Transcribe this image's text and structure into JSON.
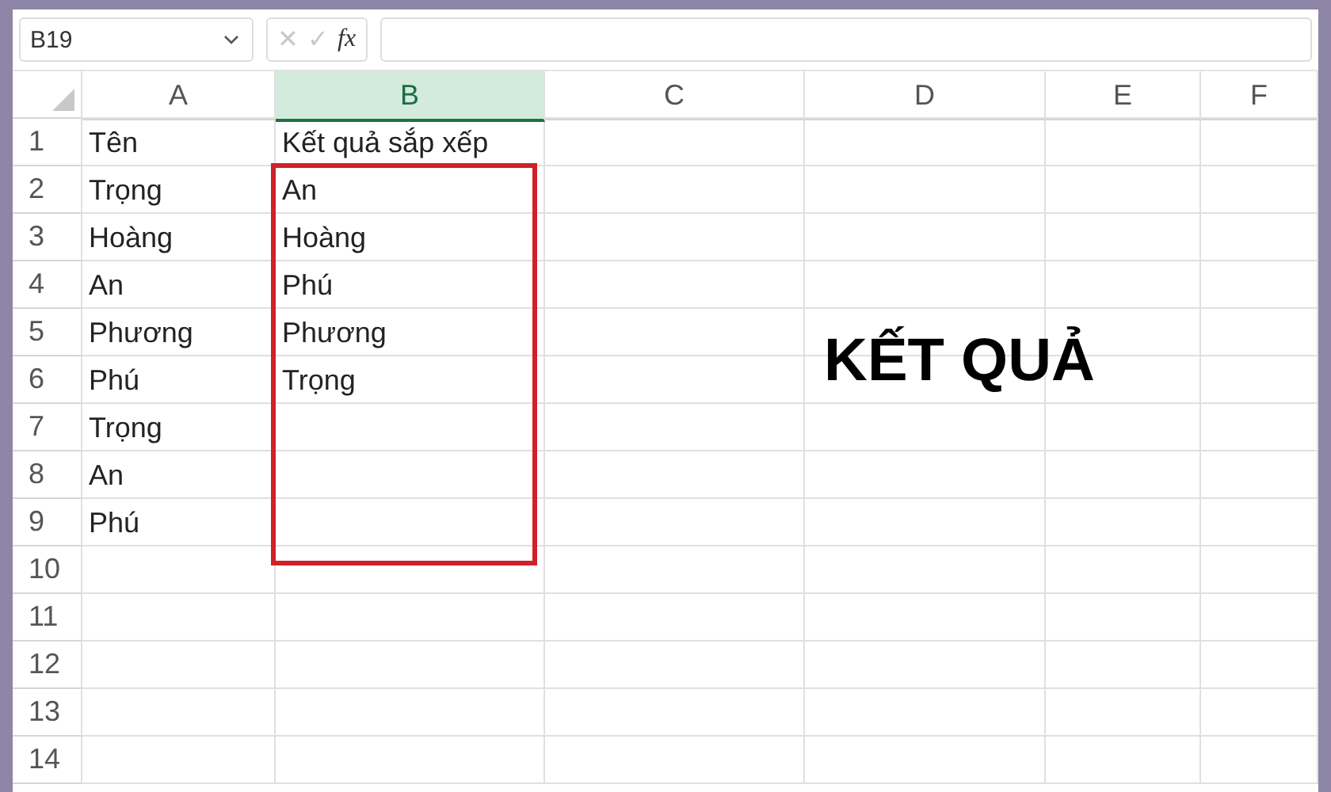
{
  "formula_bar": {
    "name_box": "B19",
    "cancel": "✕",
    "enter": "✓",
    "function": "fx"
  },
  "columns": [
    {
      "label": "A",
      "selected": false
    },
    {
      "label": "B",
      "selected": true
    },
    {
      "label": "C",
      "selected": false
    },
    {
      "label": "D",
      "selected": false
    },
    {
      "label": "E",
      "selected": false
    },
    {
      "label": "F",
      "selected": false
    }
  ],
  "rows": [
    {
      "number": "1",
      "cells": [
        "Tên",
        "Kết quả sắp xếp"
      ]
    },
    {
      "number": "2",
      "cells": [
        "Trọng",
        "An"
      ]
    },
    {
      "number": "3",
      "cells": [
        "Hoàng",
        "Hoàng"
      ]
    },
    {
      "number": "4",
      "cells": [
        "An",
        "Phú"
      ]
    },
    {
      "number": "5",
      "cells": [
        "Phương",
        "Phương"
      ]
    },
    {
      "number": "6",
      "cells": [
        "Phú",
        "Trọng"
      ]
    },
    {
      "number": "7",
      "cells": [
        "Trọng"
      ]
    },
    {
      "number": "8",
      "cells": [
        "An"
      ]
    },
    {
      "number": "9",
      "cells": [
        "Phú"
      ]
    },
    {
      "number": "10",
      "cells": []
    },
    {
      "number": "11",
      "cells": []
    },
    {
      "number": "12",
      "cells": []
    },
    {
      "number": "13",
      "cells": []
    },
    {
      "number": "14",
      "cells": []
    }
  ],
  "annotation": {
    "label": "KẾT QUẢ"
  }
}
